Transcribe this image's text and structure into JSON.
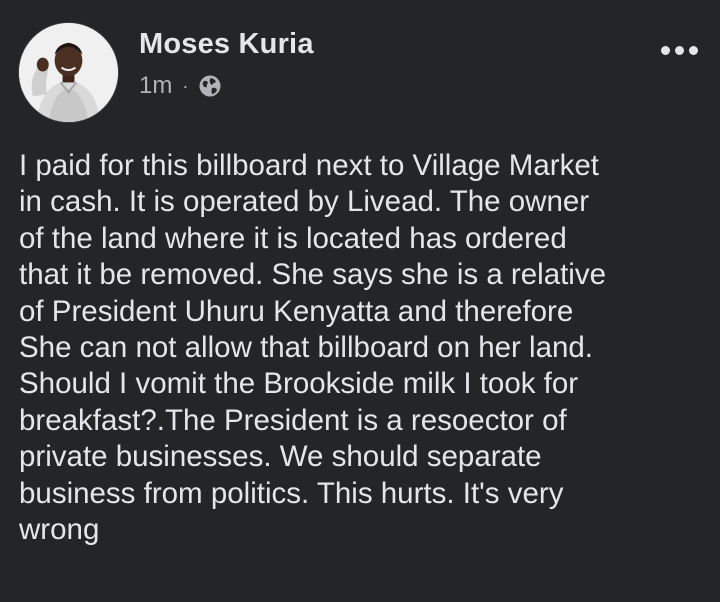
{
  "post": {
    "author": "Moses Kuria",
    "timestamp": "1m",
    "separator": "·",
    "privacy_icon": "globe-icon",
    "more_icon": "more-options-icon",
    "avatar_icon": "profile-photo",
    "text_lines": [
      "I paid for this billboard next to Village Market",
      "in cash. It is operated by Livead. The owner",
      "of the land where it is located has ordered",
      "that it be removed. She says she is a relative",
      "of President Uhuru Kenyatta and therefore",
      "She can not allow that billboard on her land.",
      "Should I vomit the Brookside milk I took for",
      "breakfast?.The President is a resoector of",
      "private businesses. We should separate",
      "business from politics. This hurts.  It's very",
      "wrong"
    ]
  },
  "colors": {
    "background": "#242526",
    "text": "#e4e6eb",
    "secondary_text": "#b0b3b8"
  }
}
